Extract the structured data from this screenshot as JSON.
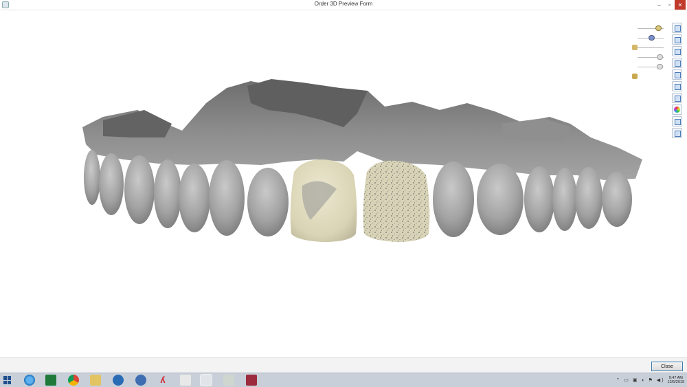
{
  "window": {
    "title": "Order 3D Preview Form",
    "controls": {
      "minimize": "–",
      "maximize": "▫",
      "close": "✕"
    }
  },
  "toolbar": {
    "right_buttons": [
      "view-icon",
      "layers-icon",
      "copy-icon",
      "stack-icon",
      "page-icon",
      "frame-icon",
      "model-icon",
      "color-wheel-icon",
      "measure-icon",
      "text-icon"
    ]
  },
  "footer": {
    "close_label": "Close"
  },
  "taskbar": {
    "apps": [
      "internet-explorer-icon",
      "excel-icon",
      "chrome-icon",
      "file-explorer-icon",
      "teamviewer-icon",
      "app-s-icon",
      "acrobat-icon",
      "dental-app-icon",
      "scan-app-icon",
      "tools-icon",
      "cube-app-icon"
    ],
    "time": "9:47 AM",
    "date": "12/5/2019"
  },
  "colors": {
    "tooth_gray": "#9c9c9c",
    "crown": "#e0dcc2",
    "gum": "#7e7e7e",
    "accent": "#3c7fb1"
  }
}
